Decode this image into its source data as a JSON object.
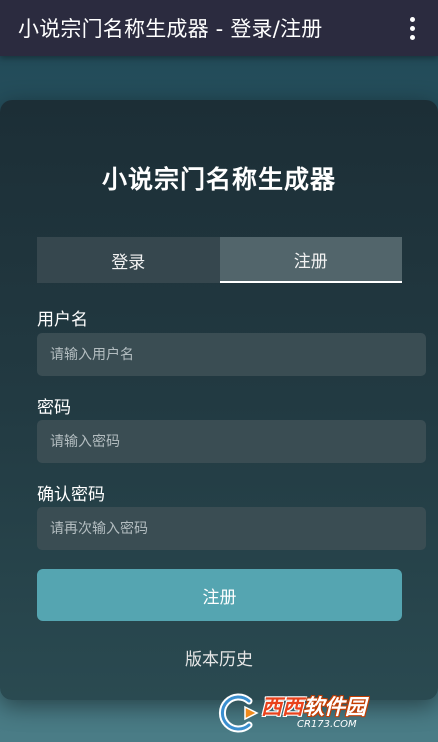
{
  "appbar": {
    "title": "小说宗门名称生成器 - 登录/注册",
    "more_icon": "more-vert-icon"
  },
  "card": {
    "title": "小说宗门名称生成器",
    "tabs": [
      {
        "label": "登录",
        "active": false
      },
      {
        "label": "注册",
        "active": true
      }
    ],
    "fields": {
      "username": {
        "label": "用户名",
        "placeholder": "请输入用户名",
        "value": ""
      },
      "password": {
        "label": "密码",
        "placeholder": "请输入密码",
        "value": ""
      },
      "confirm_password": {
        "label": "确认密码",
        "placeholder": "请再次输入密码",
        "value": ""
      }
    },
    "submit_label": "注册",
    "history_link": "版本历史"
  },
  "watermark": {
    "brand_red": "西西",
    "brand_white": "软件园",
    "domain": "CR173.COM"
  },
  "colors": {
    "appbar": "#2b2b3f",
    "card_bg": "#1c2e36",
    "accent_button": "#55a5b1",
    "tab_active": "#52656b",
    "tab_inactive": "#36474e",
    "input_bg": "#3a4d53"
  }
}
